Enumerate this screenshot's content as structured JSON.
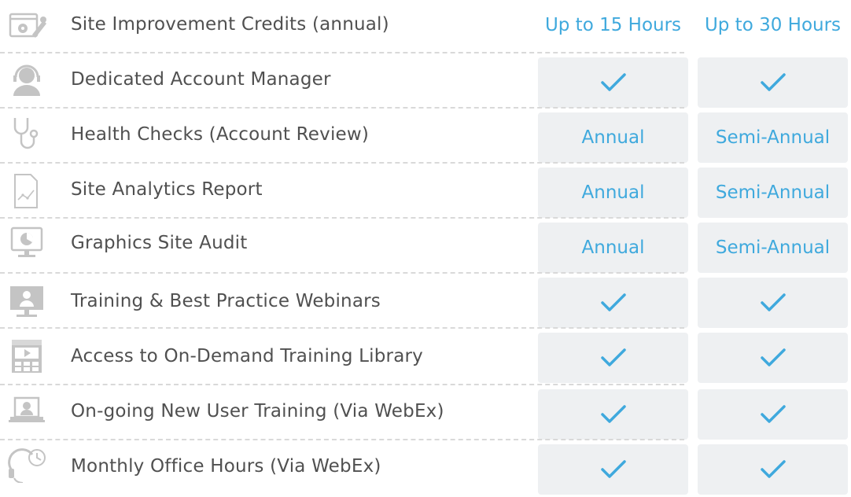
{
  "colors": {
    "accent": "#3fa9dd",
    "cell_bg": "#eef0f2",
    "text": "#505050",
    "icon": "#c4c4c4"
  },
  "rows": [
    {
      "label": "Site Improvement Credits (annual)",
      "icon": "settings-wrench-icon",
      "col1": "Up to 15 Hours",
      "col2": "Up to 30 Hours"
    },
    {
      "label": "Dedicated Account Manager",
      "icon": "headset-person-icon",
      "col1": "check",
      "col2": "check"
    },
    {
      "label": "Health Checks (Account Review)",
      "icon": "stethoscope-icon",
      "col1": "Annual",
      "col2": "Semi-Annual"
    },
    {
      "label": "Site Analytics Report",
      "icon": "report-chart-icon",
      "col1": "Annual",
      "col2": "Semi-Annual"
    },
    {
      "label": "Graphics Site Audit",
      "icon": "monitor-pie-icon",
      "col1": "Annual",
      "col2": "Semi-Annual"
    },
    {
      "label": "Training & Best Practice Webinars",
      "icon": "webinar-monitor-icon",
      "col1": "check",
      "col2": "check"
    },
    {
      "label": "Access to On-Demand Training Library",
      "icon": "video-library-icon",
      "col1": "check",
      "col2": "check"
    },
    {
      "label": "On-going New User Training (Via WebEx)",
      "icon": "laptop-user-icon",
      "col1": "check",
      "col2": "check"
    },
    {
      "label": "Monthly Office Hours (Via WebEx)",
      "icon": "headset-clock-icon",
      "col1": "check",
      "col2": "check"
    }
  ]
}
